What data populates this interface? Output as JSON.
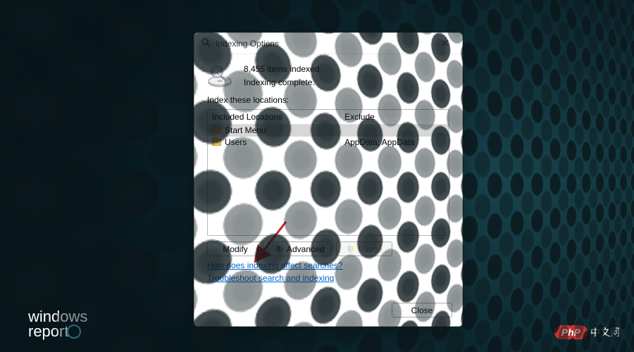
{
  "dialog": {
    "title": "Indexing Options",
    "items_indexed": "8,455 items indexed",
    "status": "Indexing complete.",
    "section_label": "Index these locations:",
    "columns": {
      "included": "Included Locations",
      "exclude": "Exclude"
    },
    "rows": [
      {
        "name": "Start Menu",
        "exclude": ""
      },
      {
        "name": "Users",
        "exclude": "AppData; AppData"
      }
    ],
    "buttons": {
      "modify": "Modify",
      "advanced": "Advanced",
      "pause": "Pause",
      "close": "Close"
    },
    "links": {
      "how": "How does indexing affect searches?",
      "troubleshoot": "Troubleshoot search and indexing"
    }
  },
  "watermarks": {
    "windows_report_l1": "windows",
    "windows_report_l2": "report",
    "php_badge": "PhP",
    "php_text": "中文网"
  }
}
